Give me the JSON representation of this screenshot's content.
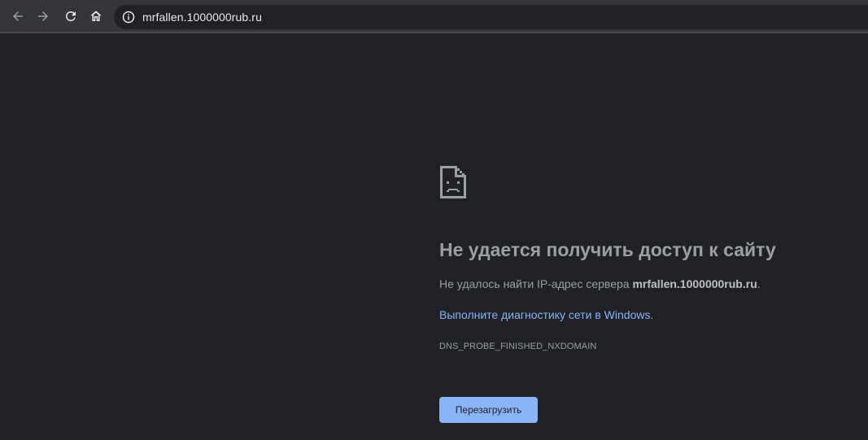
{
  "browser": {
    "url": "mrfallen.1000000rub.ru",
    "icons": {
      "back": "arrow-left-icon",
      "forward": "arrow-right-icon",
      "reload": "reload-icon",
      "home": "home-icon",
      "site_info": "info-icon"
    }
  },
  "error_page": {
    "icon": "sad-page-icon",
    "title": "Не удается получить доступ к сайту",
    "description_prefix": "Не удалось найти IP-адрес сервера ",
    "host": "mrfallen.1000000rub.ru",
    "description_suffix": ".",
    "diagnostics_link": "Выполните диагностику сети в Windows",
    "diagnostics_suffix": ".",
    "error_code": "DNS_PROBE_FINISHED_NXDOMAIN",
    "reload_button": "Перезагрузить"
  },
  "colors": {
    "background": "#202124",
    "toolbar": "#35363a",
    "text_muted": "#9aa0a6",
    "link": "#8ab4f8",
    "button": "#8ab4f8"
  }
}
